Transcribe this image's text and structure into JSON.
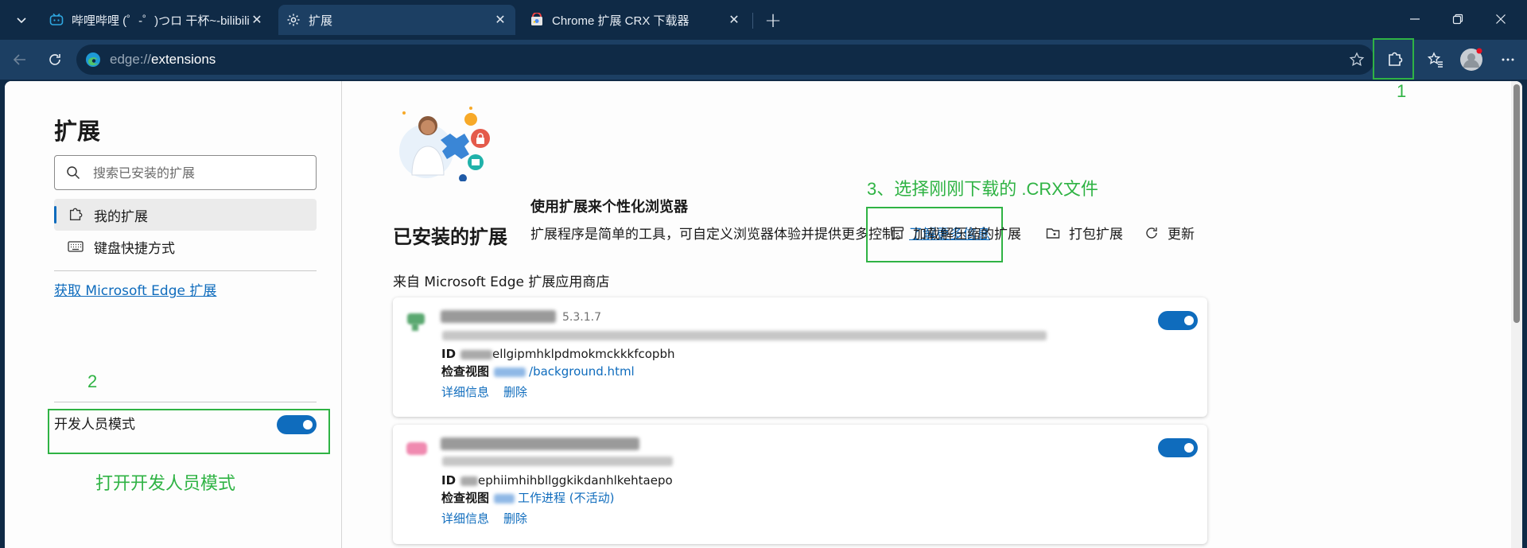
{
  "tabs": [
    {
      "title": "哔哩哔哩 (゜-゜)つロ 干杯~-bilibili",
      "close": "✕"
    },
    {
      "title": "扩展",
      "close": "✕"
    },
    {
      "title": "Chrome 扩展 CRX 下载器",
      "close": "✕"
    }
  ],
  "new_tab": "+",
  "address": {
    "scheme": "edge://",
    "path": "extensions"
  },
  "annotations": {
    "step1": "1",
    "step2": "2",
    "step3": "3、选择刚刚下载的 .CRX文件",
    "dev_hint": "打开开发人员模式",
    "color": "#2fb344"
  },
  "sidebar": {
    "title": "扩展",
    "search_placeholder": "搜索已安装的扩展",
    "items": [
      {
        "label": "我的扩展",
        "icon": "puzzle-icon",
        "selected": true
      },
      {
        "label": "键盘快捷方式",
        "icon": "keyboard-icon",
        "selected": false
      }
    ],
    "get_link": "获取 Microsoft Edge 扩展",
    "dev_mode_label": "开发人员模式",
    "dev_mode_on": true
  },
  "banner": {
    "title": "使用扩展来个性化浏览器",
    "desc": "扩展程序是简单的工具，可自定义浏览器体验并提供更多控制。",
    "link": "了解更多信息"
  },
  "installed": {
    "title": "已安装的扩展",
    "actions": [
      {
        "label": "加载解压缩的扩展",
        "icon": "load-unpacked-icon"
      },
      {
        "label": "打包扩展",
        "icon": "pack-icon"
      },
      {
        "label": "更新",
        "icon": "refresh-icon"
      }
    ],
    "source_label": "来自 Microsoft Edge 扩展应用商店",
    "extensions": [
      {
        "version": "5.3.1.7",
        "id_label": "ID",
        "id_value": "ellgipmhklpdmokmckkkfcopbh",
        "inspect_label": "检查视图",
        "inspect_link": "/background.html",
        "details": "详细信息",
        "remove": "删除",
        "enabled": true
      },
      {
        "version": "",
        "id_label": "ID",
        "id_value": "ephiimhihbllggkikdanhlkehtaepo",
        "inspect_label": "检查视图",
        "inspect_link": "工作进程 (不活动)",
        "details": "详细信息",
        "remove": "删除",
        "enabled": true
      }
    ]
  },
  "colors": {
    "accent": "#0f6cbd",
    "chrome_dark": "#0f2a46",
    "toolbar": "#1c3f63"
  }
}
